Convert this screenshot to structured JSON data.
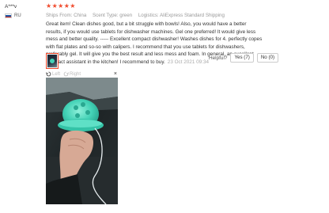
{
  "user": {
    "name": "A***v",
    "country_code": "RU",
    "flag_colors": [
      "#ffffff",
      "#1c57a5",
      "#d52b1e"
    ]
  },
  "review": {
    "stars": "★★★★★",
    "rating": 5,
    "ships_from_label": "Ships From:",
    "ships_from_value": "China",
    "scent_label": "Scent Type:",
    "scent_value": "green",
    "logistics_label": "Logistics:",
    "logistics_value": "AliExpress Standard Shipping",
    "text": "Great item! Clean dishes good, but a bit struggle with bowls! Also, you would have a better results, if you would use tablets for dishwasher machines. Gel one preferred! It would give less mess and better quality. ----- Excellent compact dishwasher! Washes dishes for 4. perfectly copes with flat plates and so-so with calipers. I recommend that you use tablets for dishwashers, preferably gel. It will give you the best result and less mess and foam. In general, an excellent compact assistant in the kitchen! I recommend to buy.",
    "date": "23 Oct 2021 09:34"
  },
  "helpful": {
    "label": "Helpful?",
    "yes_label": "Yes (7)",
    "no_label": "No (0)"
  },
  "viewer": {
    "left_label": "Left",
    "right_label": "Right",
    "close_label": "×"
  },
  "colors": {
    "star": "#f04b2d",
    "thumb_border": "#f04b2d",
    "product": "#43d2b6"
  },
  "icons": {
    "rotate_left": "rotate-left-icon",
    "rotate_right": "rotate-right-icon",
    "close": "close-icon"
  }
}
